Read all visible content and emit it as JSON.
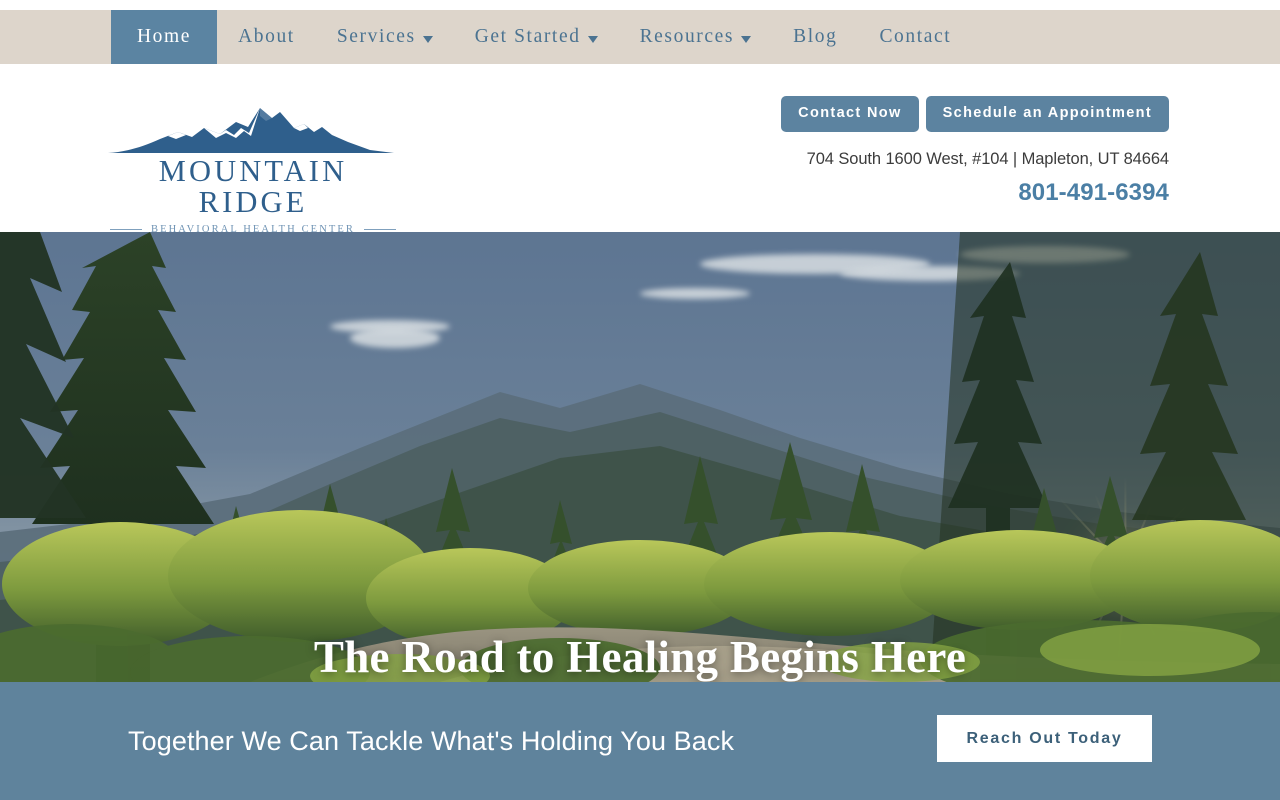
{
  "nav": {
    "items": [
      {
        "label": "Home",
        "active": true,
        "caret": false
      },
      {
        "label": "About",
        "active": false,
        "caret": false
      },
      {
        "label": "Services",
        "active": false,
        "caret": true
      },
      {
        "label": "Get Started",
        "active": false,
        "caret": true
      },
      {
        "label": "Resources",
        "active": false,
        "caret": true
      },
      {
        "label": "Blog",
        "active": false,
        "caret": false
      },
      {
        "label": "Contact",
        "active": false,
        "caret": false
      }
    ]
  },
  "logo": {
    "name": "MOUNTAIN RIDGE",
    "tagline": "BEHAVIORAL HEALTH CENTER",
    "icon": "mountain-peaks-icon"
  },
  "header": {
    "contact_button": "Contact Now",
    "schedule_button": "Schedule an Appointment",
    "address": "704 South 1600 West, #104 | Mapleton, UT 84664",
    "phone": "801-491-6394"
  },
  "hero": {
    "title": "The Road to Healing Begins Here",
    "image_alt": "mountain-meadow-forest-photo"
  },
  "cta": {
    "text": "Together We Can Tackle What's Holding You Back",
    "button": "Reach Out Today"
  },
  "colors": {
    "nav_bg": "#ddd5cb",
    "nav_link": "#4b7391",
    "nav_active_bg": "#5b84a2",
    "brand_blue": "#2f5f8c",
    "button_blue": "#5c83a0",
    "phone_blue": "#4b7fa5",
    "cta_band": "#5f839c",
    "cta_button_text": "#3c6079"
  }
}
